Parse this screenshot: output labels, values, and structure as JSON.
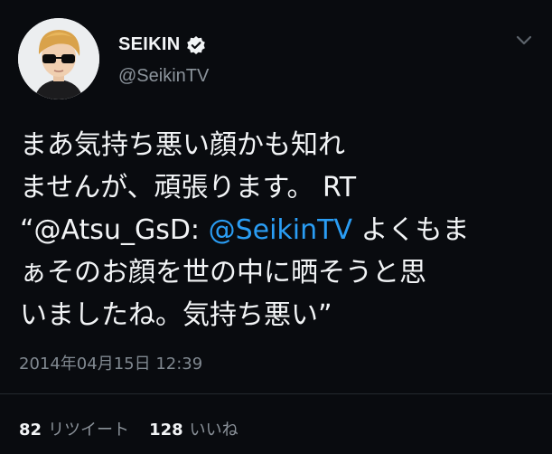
{
  "user": {
    "display_name": "SEIKIN",
    "handle": "@SeikinTV",
    "verified": true
  },
  "tweet": {
    "line1": "まあ気持ち悪い顔かも知れ",
    "line2": "ませんが、頑張ります。 RT",
    "line3_prefix": "“@Atsu_GsD: ",
    "line3_mention": "@SeikinTV",
    "line3_suffix": " よくもま",
    "line4": "ぁそのお顔を世の中に晒そうと思",
    "line5": "いましたね。気持ち悪い”"
  },
  "timestamp": "2014年04月15日 12:39",
  "stats": {
    "retweets_count": "82",
    "retweets_label": "リツイート",
    "likes_count": "128",
    "likes_label": "いいね"
  },
  "colors": {
    "background": "#090b0f",
    "mention": "#2a9df4",
    "muted": "#8c949c"
  },
  "icons": {
    "verified": "verified-badge-icon",
    "menu": "chevron-down-icon"
  }
}
